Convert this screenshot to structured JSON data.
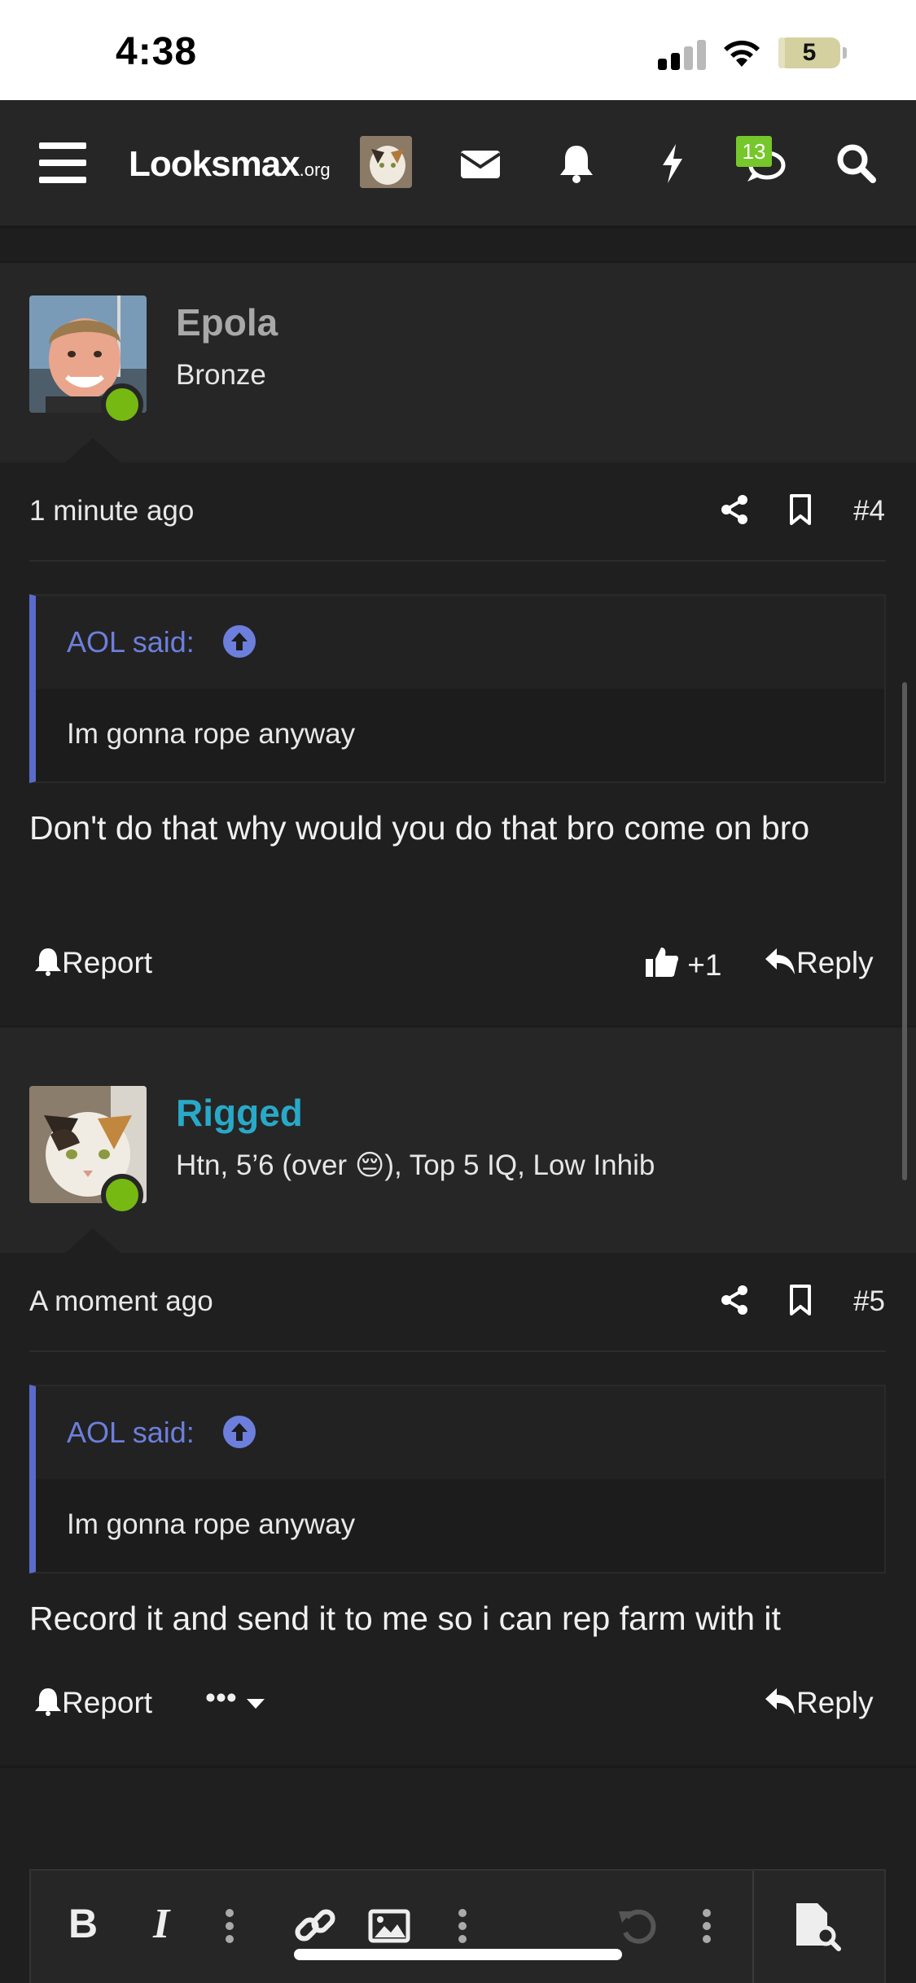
{
  "status_bar": {
    "time": "4:38",
    "battery": "5",
    "battery_level": 0.05
  },
  "header": {
    "logo_main": "Looksmax",
    "logo_suffix": ".org",
    "conversations_badge": "13",
    "icons": [
      "menu-icon",
      "avatar",
      "envelope-icon",
      "bell-icon",
      "bolt-icon",
      "chat-icon",
      "search-icon"
    ]
  },
  "posts": [
    {
      "username": "Epola",
      "user_title": "Bronze",
      "username_color": "#a8a8a8",
      "time": "1 minute ago",
      "number": "#4",
      "quote": {
        "author": "AOL said:",
        "text": "Im gonna rope anyway"
      },
      "message": "Don't do that why would you do that bro come on bro",
      "actions": {
        "report": "Report",
        "reaction_count": "+1",
        "reply": "Reply"
      }
    },
    {
      "username": "Rigged",
      "user_title_before": "Htn, 5’6 (over ",
      "user_title_emoji": "😔",
      "user_title_after": "), Top 5 IQ, Low Inhib",
      "username_color": "#29a9c8",
      "time": "A moment ago",
      "number": "#5",
      "quote": {
        "author": "AOL said:",
        "text": "Im gonna rope anyway"
      },
      "message": "Record it and send it to me so i can rep farm with it",
      "actions": {
        "report": "Report",
        "more": "•••",
        "reply": "Reply"
      }
    }
  ],
  "editor_toolbar": {
    "buttons": [
      "bold-icon",
      "italic-icon",
      "more-icon",
      "link-icon",
      "image-icon",
      "more-icon",
      "undo-icon",
      "more-icon",
      "preview-icon"
    ]
  },
  "colors": {
    "accent": "#6d7fdc",
    "online": "#76b913",
    "badge": "#76c72b"
  }
}
